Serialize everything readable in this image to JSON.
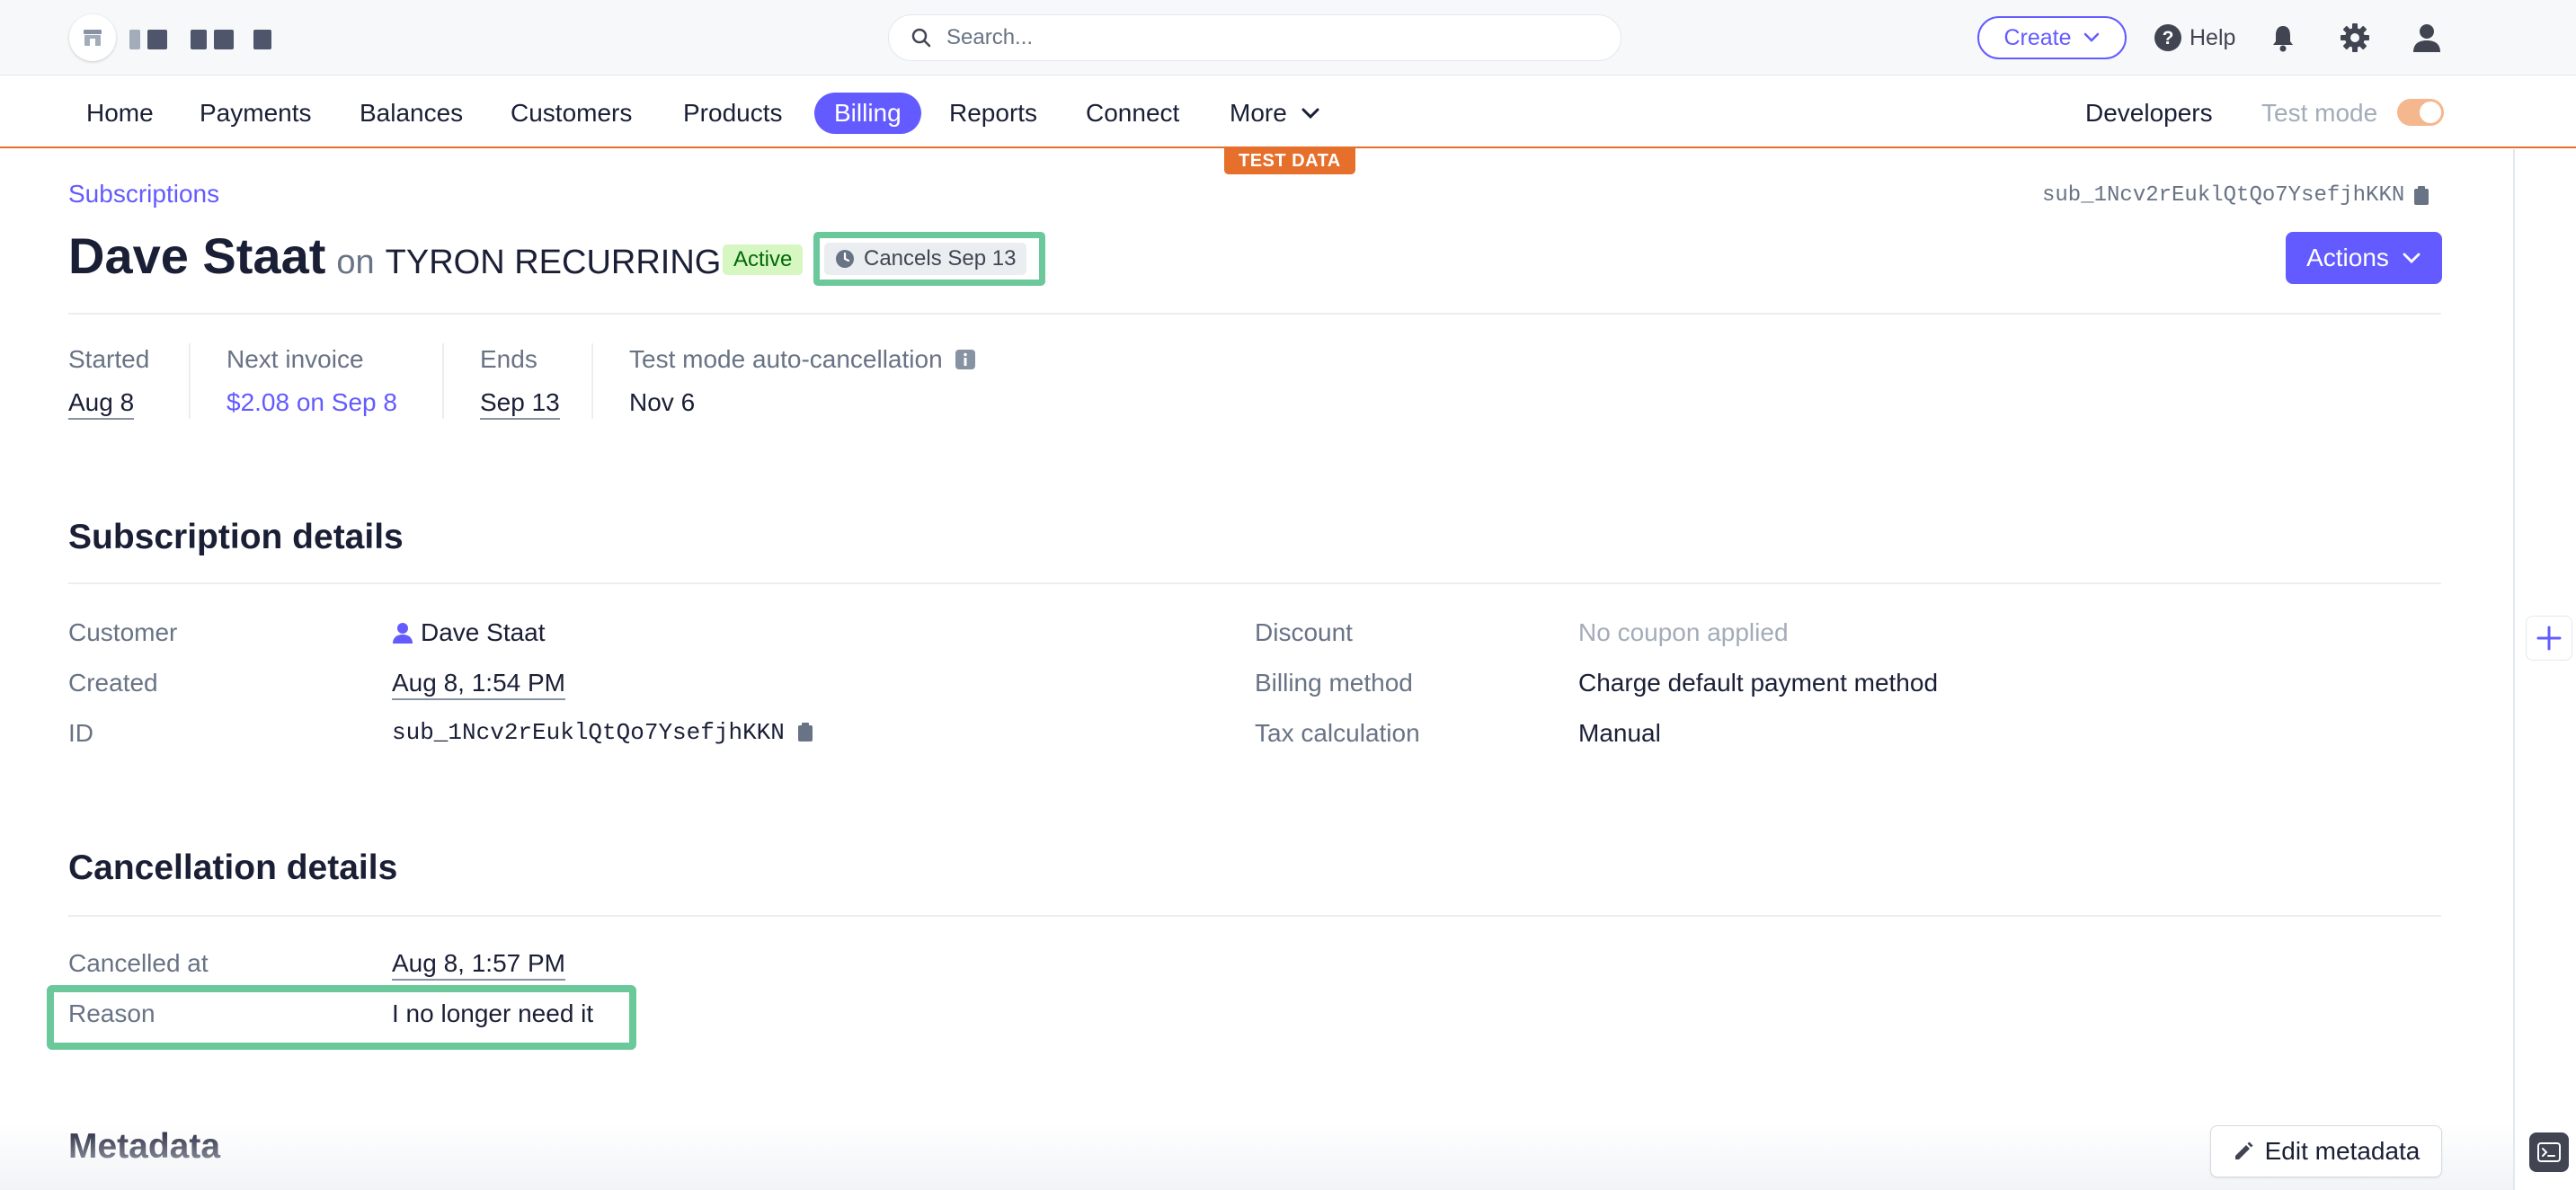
{
  "topbar": {
    "search_placeholder": "Search...",
    "create_label": "Create",
    "help_label": "Help"
  },
  "nav": {
    "items": [
      "Home",
      "Payments",
      "Balances",
      "Customers",
      "Products",
      "Billing",
      "Reports",
      "Connect",
      "More"
    ],
    "active": "Billing",
    "developers_label": "Developers",
    "test_mode_label": "Test mode",
    "test_mode_on": true,
    "test_data_badge": "TEST DATA"
  },
  "header": {
    "breadcrumb": "Subscriptions",
    "subscription_id": "sub_1Ncv2rEuklQtQo7YsefjhKKN",
    "customer_name": "Dave Staat",
    "on_word": "on",
    "product_name": "TYRON RECURRING",
    "status_badge": "Active",
    "cancels_badge": "Cancels Sep 13",
    "actions_label": "Actions"
  },
  "summary": {
    "started_label": "Started",
    "started_value": "Aug 8",
    "next_invoice_label": "Next invoice",
    "next_invoice_value": "$2.08 on Sep 8",
    "ends_label": "Ends",
    "ends_value": "Sep 13",
    "auto_cancel_label": "Test mode auto-cancellation",
    "auto_cancel_value": "Nov 6"
  },
  "subscription_details": {
    "title": "Subscription details",
    "customer_label": "Customer",
    "customer_value": "Dave Staat",
    "created_label": "Created",
    "created_value": "Aug 8, 1:54 PM",
    "id_label": "ID",
    "id_value": "sub_1Ncv2rEuklQtQo7YsefjhKKN",
    "discount_label": "Discount",
    "discount_value": "No coupon applied",
    "billing_method_label": "Billing method",
    "billing_method_value": "Charge default payment method",
    "tax_label": "Tax calculation",
    "tax_value": "Manual"
  },
  "cancellation_details": {
    "title": "Cancellation details",
    "cancelled_at_label": "Cancelled at",
    "cancelled_at_value": "Aug 8, 1:57 PM",
    "reason_label": "Reason",
    "reason_value": "I no longer need it"
  },
  "metadata": {
    "title": "Metadata",
    "edit_label": "Edit metadata"
  },
  "colors": {
    "accent": "#635bff",
    "test_mode": "#e56f2b",
    "active_badge_bg": "#d7f7c2",
    "highlight": "#6bc89a"
  }
}
